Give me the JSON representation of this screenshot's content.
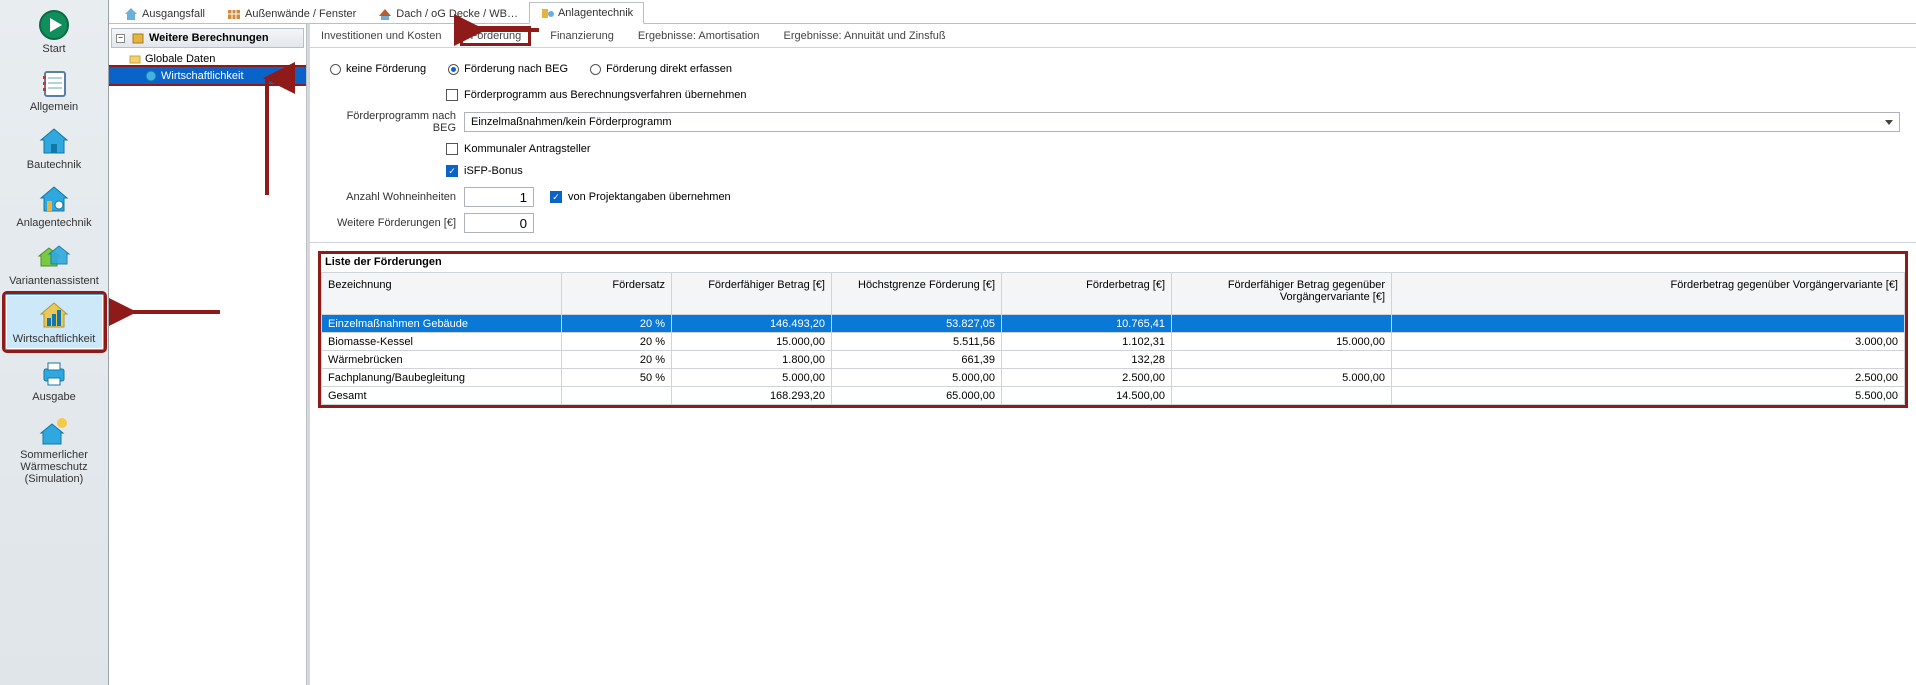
{
  "sidebar": {
    "items": [
      {
        "label": "Start"
      },
      {
        "label": "Allgemein"
      },
      {
        "label": "Bautechnik"
      },
      {
        "label": "Anlagentechnik"
      },
      {
        "label": "Variantenassistent"
      },
      {
        "label": "Wirtschaftlichkeit"
      },
      {
        "label": "Ausgabe"
      },
      {
        "label": "Sommerlicher\nWärmeschutz\n(Simulation)"
      }
    ],
    "selected_index": 5
  },
  "top_tabs": {
    "items": [
      "Ausgangsfall",
      "Außenwände / Fenster",
      "Dach / oG Decke / WB…",
      "Anlagentechnik"
    ],
    "active_index": 3
  },
  "tree": {
    "header": "Weitere Berechnungen",
    "nodes": [
      {
        "label": "Globale Daten",
        "level": 1
      },
      {
        "label": "Wirtschaftlichkeit",
        "level": 2,
        "selected": true
      }
    ]
  },
  "subtabs": {
    "items": [
      "Investitionen und Kosten",
      "Förderung",
      "Finanzierung",
      "Ergebnisse: Amortisation",
      "Ergebnisse: Annuität und Zinsfuß"
    ],
    "active_index": 1
  },
  "form": {
    "radios": {
      "none": "keine Förderung",
      "beg": "Förderung nach BEG",
      "direct": "Förderung direkt erfassen",
      "selected": "beg"
    },
    "take_from_calc": {
      "label": "Förderprogramm aus Berechnungsverfahren übernehmen",
      "checked": false
    },
    "program_label": "Förderprogramm nach BEG",
    "program_value": "Einzelmaßnahmen/kein Förderprogramm",
    "kommunal": {
      "label": "Kommunaler Antragsteller",
      "checked": false
    },
    "isfp": {
      "label": "iSFP-Bonus",
      "checked": true
    },
    "units_label": "Anzahl Wohneinheiten",
    "units_value": "1",
    "units_project": {
      "label": "von Projektangaben übernehmen",
      "checked": true
    },
    "further_label": "Weitere Förderungen [€]",
    "further_value": "0"
  },
  "table": {
    "caption": "Liste der Förderungen",
    "headers": [
      "Bezeichnung",
      "Fördersatz",
      "Förderfähiger Betrag [€]",
      "Höchstgrenze Förderung [€]",
      "Förderbetrag [€]",
      "Förderfähiger Betrag gegenüber Vorgängervariante [€]",
      "Förderbetrag gegenüber Vorgängervariante [€]"
    ],
    "rows": [
      {
        "selected": true,
        "c0": "Einzelmaßnahmen Gebäude",
        "c1": "20 %",
        "c2": "146.493,20",
        "c3": "53.827,05",
        "c4": "10.765,41",
        "c5": "",
        "c6": ""
      },
      {
        "selected": false,
        "c0": "Biomasse-Kessel",
        "c1": "20 %",
        "c2": "15.000,00",
        "c3": "5.511,56",
        "c4": "1.102,31",
        "c5": "15.000,00",
        "c6": "3.000,00"
      },
      {
        "selected": false,
        "c0": "Wärmebrücken",
        "c1": "20 %",
        "c2": "1.800,00",
        "c3": "661,39",
        "c4": "132,28",
        "c5": "",
        "c6": ""
      },
      {
        "selected": false,
        "c0": "Fachplanung/Baubegleitung",
        "c1": "50 %",
        "c2": "5.000,00",
        "c3": "5.000,00",
        "c4": "2.500,00",
        "c5": "5.000,00",
        "c6": "2.500,00"
      },
      {
        "selected": false,
        "c0": "Gesamt",
        "c1": "",
        "c2": "168.293,20",
        "c3": "65.000,00",
        "c4": "14.500,00",
        "c5": "",
        "c6": "5.500,00"
      }
    ]
  }
}
